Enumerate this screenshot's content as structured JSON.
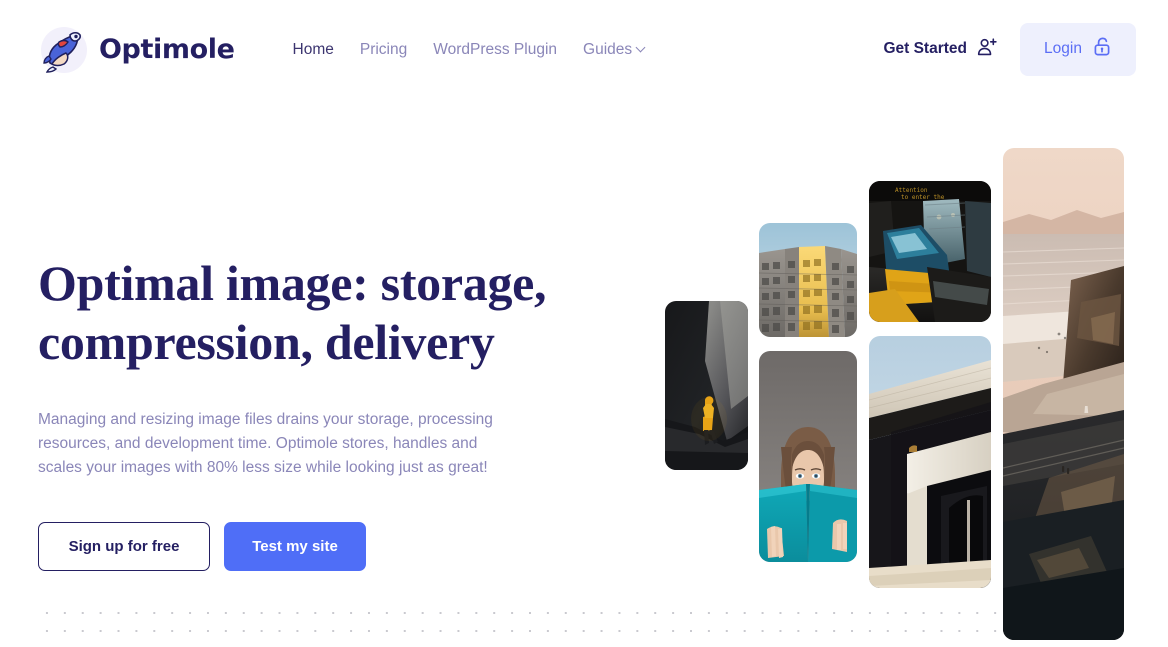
{
  "header": {
    "brand": {
      "name": "Optimole",
      "logo_icon": "mole-mascot-logo",
      "logo_color": "#4a63d8"
    },
    "nav": [
      {
        "label": "Home",
        "active": true,
        "icon": null
      },
      {
        "label": "Pricing",
        "active": false,
        "icon": null
      },
      {
        "label": "WordPress Plugin",
        "active": false,
        "icon": null
      },
      {
        "label": "Guides",
        "active": false,
        "icon": "chevron-down-icon"
      }
    ],
    "get_started": {
      "label": "Get Started",
      "icon": "user-plus-icon"
    },
    "login": {
      "label": "Login",
      "icon": "unlock-padlock-icon",
      "bg_color": "#eef0fd",
      "text_color": "#5b6ef5"
    }
  },
  "hero": {
    "title_line_1": "Optimal image: storage,",
    "title_line_2": "compression, delivery",
    "title_color": "#241f62",
    "subtitle": "Managing and resizing image files drains your storage, processing resources, and development time. Optimole stores, handles and scales your images with 80% less size while looking just as great!",
    "subtitle_color": "#8a86b8",
    "buttons": {
      "secondary_label": "Sign up for free",
      "primary_label": "Test my site",
      "primary_color": "#4f6ef7"
    }
  },
  "collage": {
    "images": [
      {
        "name": "cave-hiker-photo",
        "alt": "Hiker in yellow jacket inside a dark cave"
      },
      {
        "name": "building-facade-photo",
        "alt": "Upward view of apartment building with sunlit yellow stripe"
      },
      {
        "name": "woman-reading-book-photo",
        "alt": "Woman holding a teal book in front of her face"
      },
      {
        "name": "train-station-photo",
        "alt": "Blue and yellow train at a covered station platform"
      },
      {
        "name": "bridge-underpass-photo",
        "alt": "Concrete overpass bridge against blue sky"
      },
      {
        "name": "coastal-cliff-photo",
        "alt": "Coastal cliffs and railway at dusk"
      }
    ]
  },
  "decor": {
    "dot_grid_color": "#c9c9cf"
  }
}
